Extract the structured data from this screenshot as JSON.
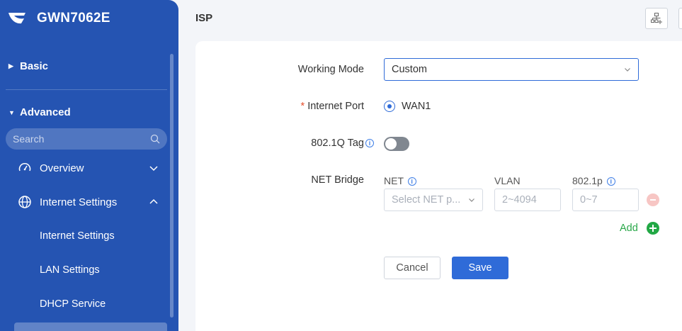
{
  "sidebar": {
    "brand": "GWN7062E",
    "basic_label": "Basic",
    "advanced_label": "Advanced",
    "search_placeholder": "Search",
    "items": [
      {
        "label": "Overview"
      },
      {
        "label": "Internet Settings"
      }
    ],
    "sub_items": [
      {
        "label": "Internet Settings"
      },
      {
        "label": "LAN Settings"
      },
      {
        "label": "DHCP Service"
      }
    ]
  },
  "header": {
    "title": "ISP"
  },
  "form": {
    "working_mode": {
      "label": "Working Mode",
      "value": "Custom"
    },
    "internet_port": {
      "label": "Internet Port",
      "option": "WAN1",
      "selected": true
    },
    "tag": {
      "label": "802.1Q Tag",
      "enabled": false
    },
    "net_bridge": {
      "label": "NET Bridge",
      "col_net": "NET",
      "col_vlan": "VLAN",
      "col_prio": "802.1p",
      "net_placeholder": "Select NET p...",
      "vlan_placeholder": "2~4094",
      "prio_placeholder": "0~7",
      "add_label": "Add"
    },
    "cancel_label": "Cancel",
    "save_label": "Save"
  },
  "colors": {
    "sidebar": "#2554b2",
    "primary": "#2f6bd8",
    "add": "#22a845",
    "remove": "#f7c6c4"
  }
}
